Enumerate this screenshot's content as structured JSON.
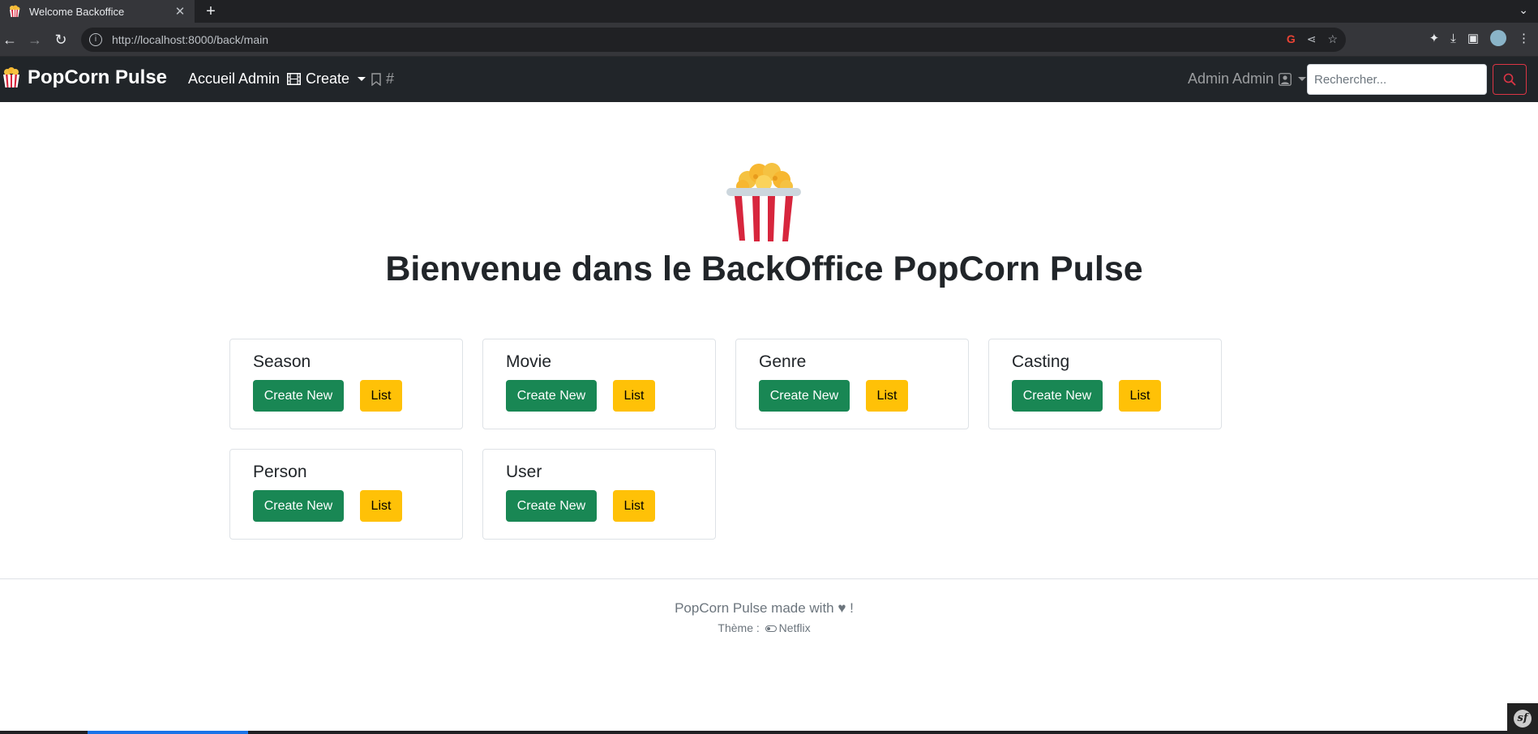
{
  "browser": {
    "tab_title": "Welcome Backoffice",
    "tab_close": "✕",
    "new_tab": "+",
    "url": "http://localhost:8000/back/main"
  },
  "navbar": {
    "brand": "PopCorn Pulse",
    "home_link": "Accueil Admin",
    "create_menu": "Create",
    "bookmark_link": "#",
    "user_menu": "Admin Admin",
    "search_placeholder": "Rechercher..."
  },
  "main": {
    "title": "Bienvenue dans le BackOffice PopCorn Pulse",
    "cards": [
      {
        "title": "Season",
        "create_label": "Create New",
        "list_label": "List"
      },
      {
        "title": "Movie",
        "create_label": "Create New",
        "list_label": "List"
      },
      {
        "title": "Genre",
        "create_label": "Create New",
        "list_label": "List"
      },
      {
        "title": "Casting",
        "create_label": "Create New",
        "list_label": "List"
      },
      {
        "title": "Person",
        "create_label": "Create New",
        "list_label": "List"
      },
      {
        "title": "User",
        "create_label": "Create New",
        "list_label": "List"
      }
    ]
  },
  "footer": {
    "made_with": "PopCorn Pulse made with ♥ !",
    "theme_prefix": "Thème :",
    "theme_name": "Netflix"
  },
  "colors": {
    "navbar_bg": "#212529",
    "create_button": "#198754",
    "list_button": "#ffc107",
    "search_button_border": "#dc3545"
  }
}
